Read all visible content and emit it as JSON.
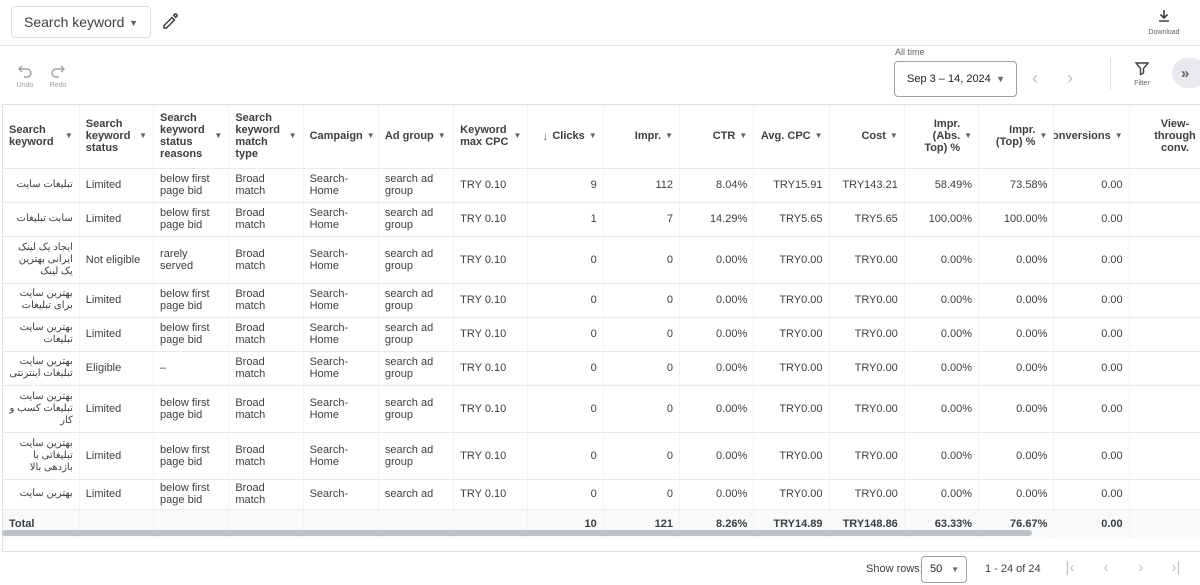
{
  "header": {
    "keyword_select": "Search keyword",
    "download_label": "Download"
  },
  "toolbar": {
    "undo_label": "Undo",
    "redo_label": "Redo",
    "date_caption": "All time",
    "date_range": "Sep 3 – 14, 2024",
    "filter_label": "Filter"
  },
  "table": {
    "columns": [
      "Search keyword",
      "Search keyword status",
      "Search keyword status reasons",
      "Search keyword match type",
      "Campaign",
      "Ad group",
      "Keyword max CPC",
      "Clicks",
      "Impr.",
      "CTR",
      "Avg. CPC",
      "Cost",
      "Impr. (Abs. Top) %",
      "Impr. (Top) %",
      "onversions",
      "View-through conv."
    ],
    "rows": [
      [
        "تبلیغات سایت",
        "Limited",
        "below first page bid",
        "Broad match",
        "Search-Home",
        "search ad group",
        "TRY 0.10",
        "9",
        "112",
        "8.04%",
        "TRY15.91",
        "TRY143.21",
        "58.49%",
        "73.58%",
        "0.00",
        ""
      ],
      [
        "سایت تبلیغات",
        "Limited",
        "below first page bid",
        "Broad match",
        "Search-Home",
        "search ad group",
        "TRY 0.10",
        "1",
        "7",
        "14.29%",
        "TRY5.65",
        "TRY5.65",
        "100.00%",
        "100.00%",
        "0.00",
        ""
      ],
      [
        "ایجاد یک لینک ایرانی بهترین یک لینک",
        "Not eligible",
        "rarely served",
        "Broad match",
        "Search-Home",
        "search ad group",
        "TRY 0.10",
        "0",
        "0",
        "0.00%",
        "TRY0.00",
        "TRY0.00",
        "0.00%",
        "0.00%",
        "0.00",
        ""
      ],
      [
        "بهترین سایت برای تبلیغات",
        "Limited",
        "below first page bid",
        "Broad match",
        "Search-Home",
        "search ad group",
        "TRY 0.10",
        "0",
        "0",
        "0.00%",
        "TRY0.00",
        "TRY0.00",
        "0.00%",
        "0.00%",
        "0.00",
        ""
      ],
      [
        "بهترین سایت تبلیغات",
        "Limited",
        "below first page bid",
        "Broad match",
        "Search-Home",
        "search ad group",
        "TRY 0.10",
        "0",
        "0",
        "0.00%",
        "TRY0.00",
        "TRY0.00",
        "0.00%",
        "0.00%",
        "0.00",
        ""
      ],
      [
        "بهترین سایت تبلیغات اینترنتی",
        "Eligible",
        "–",
        "Broad match",
        "Search-Home",
        "search ad group",
        "TRY 0.10",
        "0",
        "0",
        "0.00%",
        "TRY0.00",
        "TRY0.00",
        "0.00%",
        "0.00%",
        "0.00",
        ""
      ],
      [
        "بهترین سایت تبلیغات کسب و کار",
        "Limited",
        "below first page bid",
        "Broad match",
        "Search-Home",
        "search ad group",
        "TRY 0.10",
        "0",
        "0",
        "0.00%",
        "TRY0.00",
        "TRY0.00",
        "0.00%",
        "0.00%",
        "0.00",
        ""
      ],
      [
        "بهترین سایت تبلیغاتی با بازدهی بالا",
        "Limited",
        "below first page bid",
        "Broad match",
        "Search-Home",
        "search ad group",
        "TRY 0.10",
        "0",
        "0",
        "0.00%",
        "TRY0.00",
        "TRY0.00",
        "0.00%",
        "0.00%",
        "0.00",
        ""
      ],
      [
        "بهترین سایت",
        "Limited",
        "below first page bid",
        "Broad match",
        "Search-",
        "search ad",
        "TRY 0.10",
        "0",
        "0",
        "0.00%",
        "TRY0.00",
        "TRY0.00",
        "0.00%",
        "0.00%",
        "0.00",
        ""
      ]
    ],
    "total": [
      "Total",
      "",
      "",
      "",
      "",
      "",
      "",
      "10",
      "121",
      "8.26%",
      "TRY14.89",
      "TRY148.86",
      "63.33%",
      "76.67%",
      "0.00",
      ""
    ]
  },
  "footer": {
    "show_rows_label": "Show rows:",
    "rows_value": "50",
    "range_text": "1 - 24 of 24"
  }
}
